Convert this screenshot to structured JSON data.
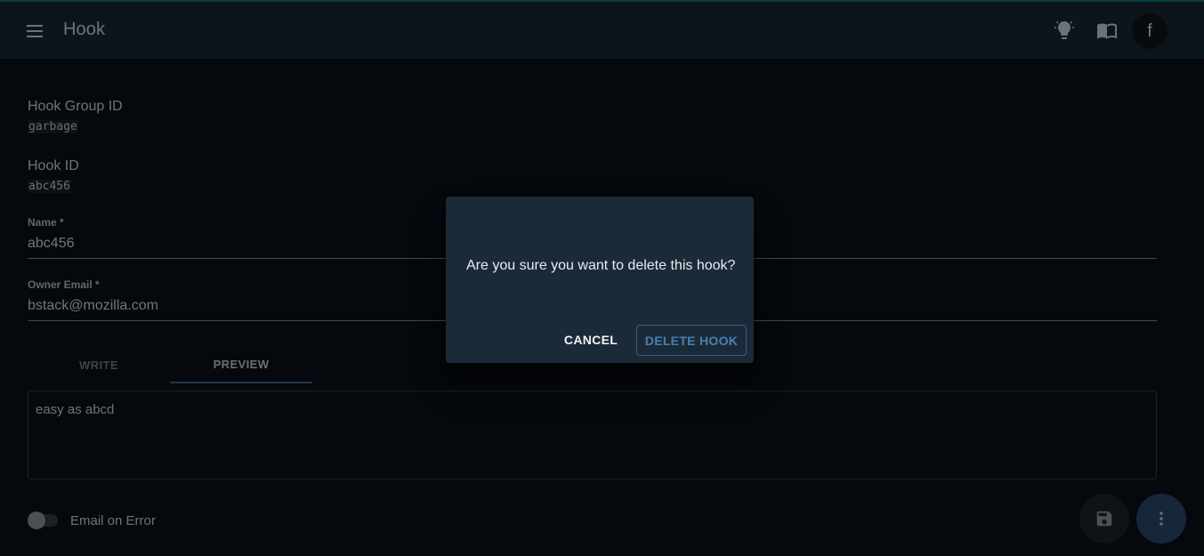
{
  "appbar": {
    "title": "Hook",
    "menu_icon": "menu-icon",
    "theme_icon": "lightbulb-icon",
    "docs_icon": "book-icon",
    "avatar_initial": "f",
    "accent_color": "#0f7f86"
  },
  "form": {
    "hook_group_id": {
      "label": "Hook Group ID",
      "value": "garbage"
    },
    "hook_id": {
      "label": "Hook ID",
      "value": "abc456"
    },
    "name": {
      "label": "Name *",
      "value": "abc456"
    },
    "owner_email": {
      "label": "Owner Email *",
      "value": "bstack@mozilla.com"
    },
    "description_tabs": [
      "WRITE",
      "PREVIEW"
    ],
    "active_tab": "PREVIEW",
    "description_preview": "easy as abcd",
    "email_on_error": {
      "label": "Email on Error",
      "checked": false
    }
  },
  "actions": {
    "save_icon": "save-icon",
    "more_icon": "more-vert-icon"
  },
  "dialog": {
    "message": "Are you sure you want to delete this hook?",
    "cancel_label": "CANCEL",
    "confirm_label": "DELETE HOOK"
  }
}
